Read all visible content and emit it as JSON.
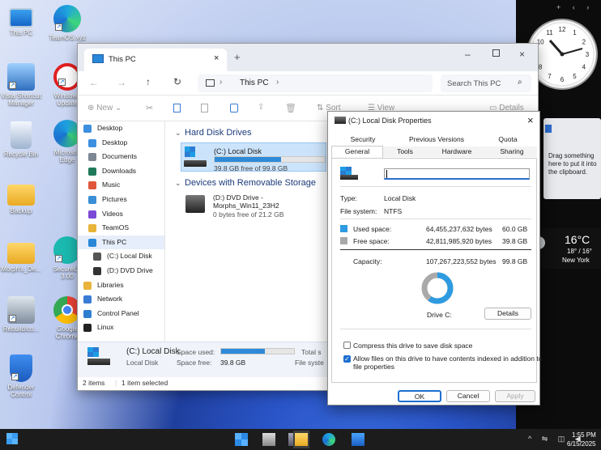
{
  "desktop_icons": [
    {
      "label": "This PC"
    },
    {
      "label": "TeamOS.xyz"
    },
    {
      "label": "Vista Shortcut Manager"
    },
    {
      "label": "Windows Update"
    },
    {
      "label": "Recycle Bin"
    },
    {
      "label": "Microsoft Edge"
    },
    {
      "label": "Backup"
    },
    {
      "label": "Morph's_De..."
    },
    {
      "label": "SecureUx 3.00"
    },
    {
      "label": "RebuildIco..."
    },
    {
      "label": "Google Chrome"
    },
    {
      "label": "Defender Control"
    }
  ],
  "gadgets": {
    "clock_numbers": [
      "12",
      "11",
      "1",
      "2",
      "3",
      "4",
      "5",
      "6",
      "7",
      "8",
      "9",
      "10"
    ],
    "clipboard_text": "Drag something here to put it into the clipboard.",
    "weather": {
      "temp": "16°C",
      "range": "18° / 16°",
      "city": "New York"
    }
  },
  "explorer": {
    "tab_title": "This PC",
    "breadcrumb": "This PC",
    "search_placeholder": "Search This PC",
    "toolbar": {
      "new": "New",
      "sort": "Sort",
      "view": "View",
      "details": "Details"
    },
    "nav": [
      "Desktop",
      "Desktop",
      "Documents",
      "Downloads",
      "Music",
      "Pictures",
      "Videos",
      "TeamOS",
      "This PC",
      "(C:) Local Disk",
      "(D:) DVD Drive",
      "Libraries",
      "Network",
      "Control Panel",
      "Linux"
    ],
    "hard_disk_header": "Hard Disk Drives",
    "c_drive": {
      "name": "(C:) Local Disk",
      "free": "39.8 GB free of 99.8 GB",
      "used_fraction": 0.6
    },
    "removable_header": "Devices with Removable Storage",
    "d_drive": {
      "name": "(D:) DVD Drive -",
      "name2": "Morphs_Win11_23H2",
      "free": "0 bytes free of 21.2 GB"
    },
    "details": {
      "name": "(C:) Local Disk",
      "type": "Local Disk",
      "space_used_label": "Space used:",
      "space_free_label": "Space free:",
      "space_free": "39.8 GB",
      "total_label": "Total s",
      "fs_label": "File syste"
    },
    "status": {
      "items": "2 items",
      "selected": "1 item selected"
    }
  },
  "props": {
    "title": "(C:) Local Disk Properties",
    "tabs_row1": [
      "Security",
      "Previous Versions",
      "Quota"
    ],
    "tabs_row2": [
      "General",
      "Tools",
      "Hardware",
      "Sharing"
    ],
    "type_label": "Type:",
    "type_value": "Local Disk",
    "fs_label": "File system:",
    "fs_value": "NTFS",
    "used_label": "Used space:",
    "used_bytes": "64,455,237,632 bytes",
    "used_gb": "60.0 GB",
    "free_label": "Free space:",
    "free_bytes": "42,811,985,920 bytes",
    "free_gb": "39.8 GB",
    "cap_label": "Capacity:",
    "cap_bytes": "107,267,223,552 bytes",
    "cap_gb": "99.8 GB",
    "drive_label": "Drive C:",
    "details_btn": "Details",
    "compress": "Compress this drive to save disk space",
    "index1": "Allow files on this drive to have contents indexed in addition to",
    "index2": "file properties",
    "ok": "OK",
    "cancel": "Cancel",
    "apply": "Apply",
    "used_fraction": 0.6,
    "colors": {
      "used": "#2e9be0",
      "free": "#a9a9a9"
    }
  },
  "taskbar": {
    "time": "1:55 PM",
    "date": "6/15/2025"
  }
}
